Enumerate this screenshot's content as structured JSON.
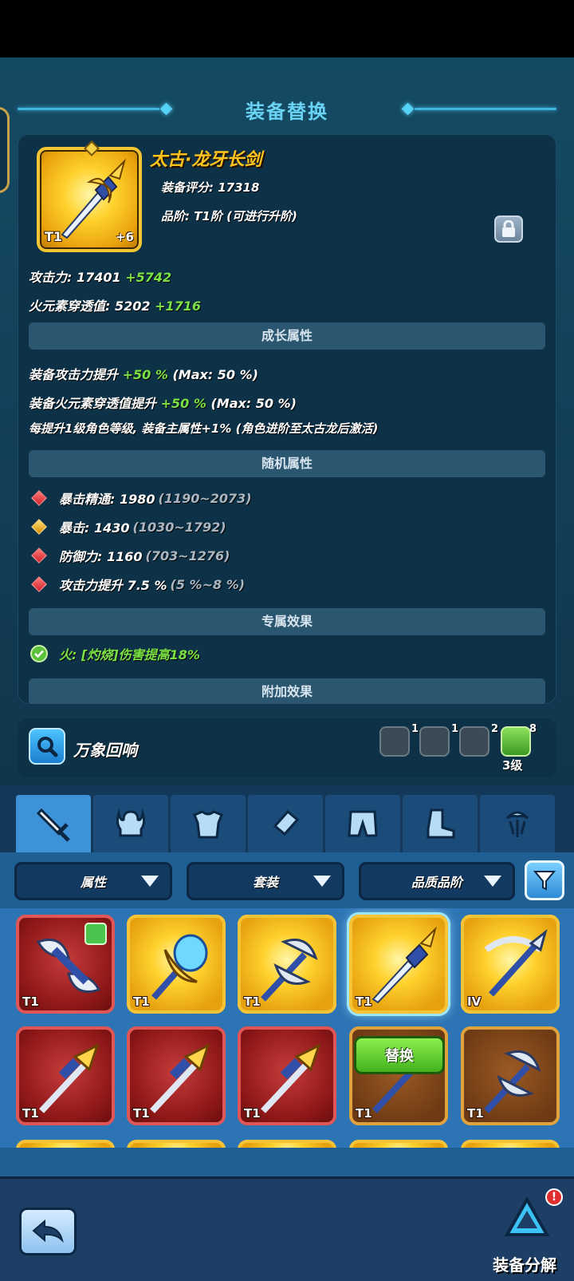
{
  "header": {
    "title": "装备替换"
  },
  "item": {
    "name": "太古·龙牙长剑",
    "score_label": "装备评分: 17318",
    "grade_label": "品阶: T1阶 (可进行升阶)",
    "tier": "T1",
    "enhance": "+6",
    "lock_icon": "lock-icon"
  },
  "main_stats": [
    {
      "label": "攻击力: 17401",
      "bonus": "+5742"
    },
    {
      "label": "火元素穿透值: 5202",
      "bonus": "+1716"
    }
  ],
  "growth": {
    "title": "成长属性",
    "lines": [
      {
        "label": "装备攻击力提升",
        "bonus": "+50 %",
        "max": "(Max: 50 %)"
      },
      {
        "label": "装备火元素穿透值提升",
        "bonus": "+50 %",
        "max": "(Max: 50 %)"
      }
    ],
    "note": "每提升1级角色等级, 装备主属性+1% (角色进阶至太古龙后激活)"
  },
  "random": {
    "title": "随机属性",
    "rows": [
      {
        "label": "暴击精通: 1980",
        "range": "(1190~2073)",
        "color": "red"
      },
      {
        "label": "暴击: 1430",
        "range": "(1030~1792)",
        "color": "gold"
      },
      {
        "label": "防御力: 1160",
        "range": "(703~1276)",
        "color": "red"
      },
      {
        "label": "攻击力提升 7.5 %",
        "range": "(5 %~8 %)",
        "color": "red"
      }
    ]
  },
  "exclusive": {
    "title": "专属效果",
    "effect": "火: [灼烧]伤害提高18%"
  },
  "extra": {
    "title": "附加效果"
  },
  "echo": {
    "label": "万象回响",
    "counts": [
      "1",
      "1",
      "2",
      "8"
    ],
    "level": "3级"
  },
  "tabs": [
    "weapon-icon",
    "helmet-icon",
    "armor-icon",
    "bracer-icon",
    "pants-icon",
    "boots-icon",
    "accessory-icon"
  ],
  "filters": {
    "attribute": "属性",
    "set": "套装",
    "quality": "品质品阶"
  },
  "inventory": [
    {
      "tier": "T1",
      "rarity": "red"
    },
    {
      "tier": "T1",
      "rarity": "gold"
    },
    {
      "tier": "T1",
      "rarity": "gold"
    },
    {
      "tier": "T1",
      "rarity": "gold"
    },
    {
      "tier": "IV",
      "rarity": "gold"
    },
    {
      "tier": "T1",
      "rarity": "red"
    },
    {
      "tier": "T1",
      "rarity": "red"
    },
    {
      "tier": "T1",
      "rarity": "red"
    },
    {
      "tier": "T1",
      "rarity": "brown"
    },
    {
      "tier": "T1",
      "rarity": "brown"
    }
  ],
  "replace_label": "替换",
  "footer": {
    "decompose_label": "装备分解",
    "alert": "!"
  },
  "colors": {
    "accent": "#6ad3f4",
    "bonus_green": "#7be245",
    "item_name_gold": "#ffc41c"
  }
}
